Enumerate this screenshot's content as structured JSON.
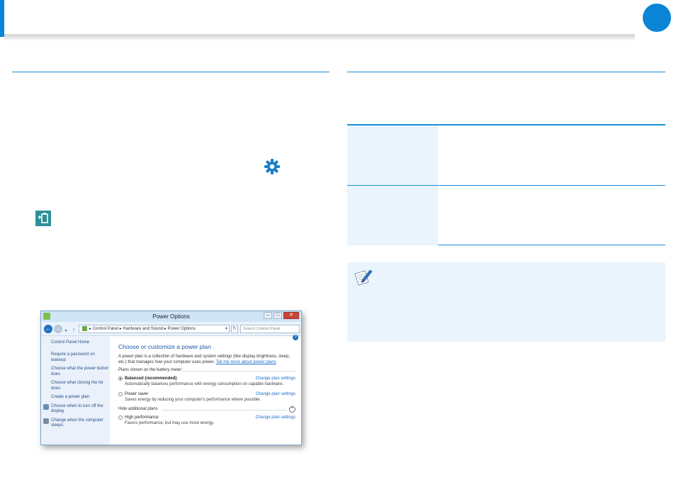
{
  "window": {
    "title": "Power Options",
    "controls": {
      "minimize": "–",
      "maximize": "□",
      "close": "✕"
    },
    "nav": {
      "back": "←",
      "forward": "→",
      "recent": "▾",
      "up": "↑",
      "refresh": "↻"
    },
    "breadcrumb": [
      "Control Panel",
      "Hardware and Sound",
      "Power Options"
    ],
    "breadcrumb_separator": "▸",
    "address_dropdown": "▾",
    "search_placeholder": "Search Control Panel",
    "help": "?"
  },
  "sidebar": {
    "home": "Control Panel Home",
    "items": [
      "Require a password on wakeup",
      "Choose what the power button does",
      "Choose what closing the lid does",
      "Create a power plan",
      "Choose when to turn off the display",
      "Change when the computer sleeps"
    ]
  },
  "main": {
    "heading": "Choose or customize a power plan",
    "intro": "A power plan is a collection of hardware and system settings (like display brightness, sleep, etc.) that manages how your computer uses power.",
    "intro_link": "Tell me more about power plans",
    "group_shown": "Plans shown on the battery meter",
    "group_hidden": "Hide additional plans",
    "collapse": "⌃",
    "change_label": "Change plan settings",
    "plans_shown": [
      {
        "name": "Balanced (recommended)",
        "desc": "Automatically balances performance with energy consumption on capable hardware.",
        "selected": true
      },
      {
        "name": "Power saver",
        "desc": "Saves energy by reducing your computer's performance where possible.",
        "selected": false
      }
    ],
    "plans_hidden": [
      {
        "name": "High performance",
        "desc": "Favors performance, but may use more energy.",
        "selected": false
      }
    ]
  },
  "icons": {
    "gear": "gear-icon",
    "charm": "settings-charm-icon",
    "note": "note-pen-icon"
  },
  "colors": {
    "accent": "#0a85d6",
    "rule": "#1b8fd8",
    "panel": "#eaf4fc",
    "charm": "#2f8f98"
  }
}
